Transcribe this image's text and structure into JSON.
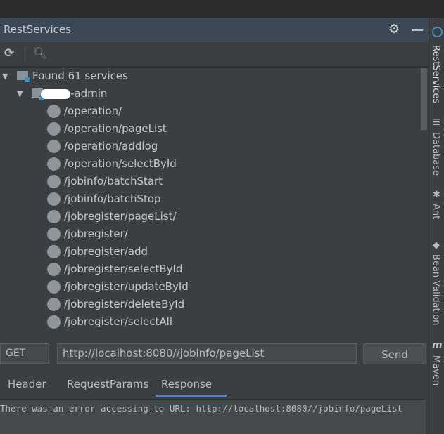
{
  "header": {
    "title": "RestServices"
  },
  "tree": {
    "root": "Found 61 services",
    "module": "-admin",
    "items": [
      "/operation/",
      "/operation/pageList",
      "/operation/addlog",
      "/operation/selectById",
      "/jobinfo/batchStart",
      "/jobinfo/batchStop",
      "/jobregister/pageList/",
      "/jobregister/",
      "/jobregister/add",
      "/jobregister/selectById",
      "/jobregister/updateById",
      "/jobregister/deleteById",
      "/jobregister/selectAll"
    ]
  },
  "request": {
    "method": "GET",
    "url": "http://localhost:8080//jobinfo/pageList",
    "send": "Send"
  },
  "tabs": [
    "Header",
    "RequestParams",
    "Response"
  ],
  "active_tab": "Response",
  "response": "There was an error accessing to URL: http://localhost:8080//jobinfo/pageList",
  "right_sidebar": [
    "RestServices",
    "Database",
    "Ant",
    "Bean Validation",
    "Maven"
  ]
}
